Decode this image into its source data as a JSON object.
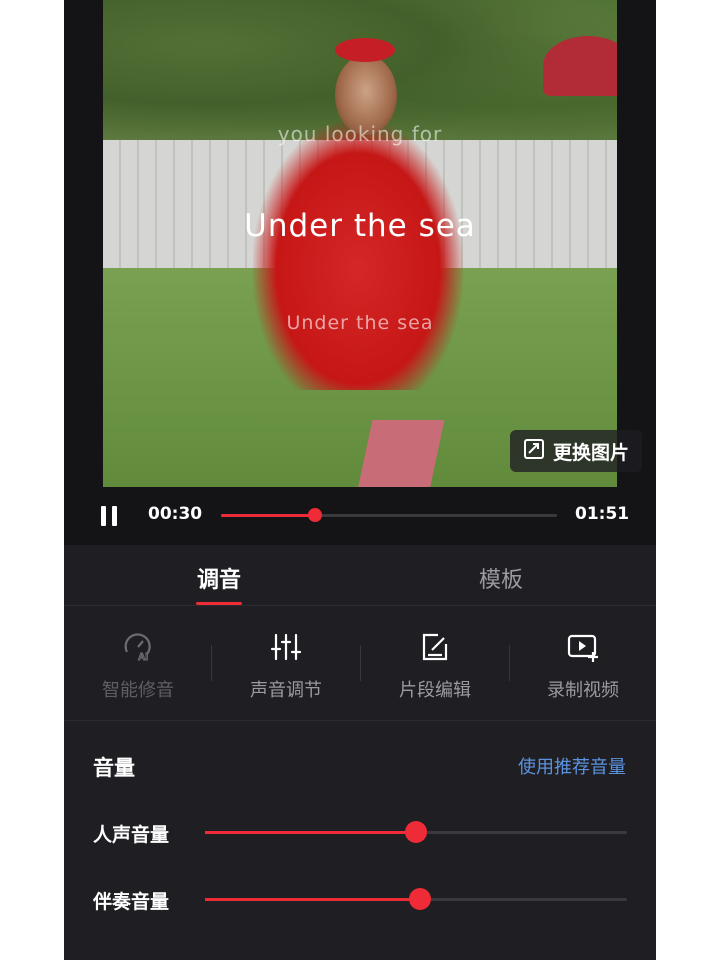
{
  "player": {
    "lyrics": {
      "previous": "you  looking  for",
      "current": "Under  the  sea",
      "next": "Under  the  sea"
    },
    "change_image_label": "更换图片",
    "current_time": "00:30",
    "total_time": "01:51",
    "progress_fraction": 0.28,
    "accent_color": "#ee2b36"
  },
  "tabs": [
    {
      "label": "调音",
      "active": true
    },
    {
      "label": "模板",
      "active": false
    }
  ],
  "tools": [
    {
      "label": "智能修音",
      "icon": "ai-tune-icon",
      "enabled": false
    },
    {
      "label": "声音调节",
      "icon": "equalizer-sliders-icon",
      "enabled": true
    },
    {
      "label": "片段编辑",
      "icon": "edit-clip-icon",
      "enabled": true
    },
    {
      "label": "录制视频",
      "icon": "record-video-icon",
      "enabled": true
    }
  ],
  "volume": {
    "title": "音量",
    "recommend_link": "使用推荐音量",
    "sliders": [
      {
        "label": "人声音量",
        "value_fraction": 0.5
      },
      {
        "label": "伴奏音量",
        "value_fraction": 0.51
      }
    ]
  }
}
